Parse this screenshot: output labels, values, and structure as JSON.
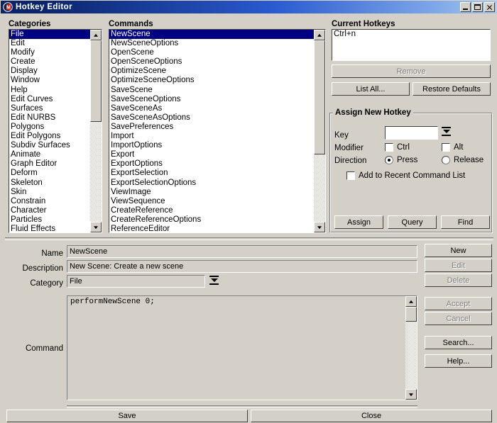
{
  "window": {
    "title": "Hotkey Editor",
    "icon": "maya-m-icon",
    "controls": {
      "minimize": "minimize-icon",
      "maximize": "maximize-icon",
      "close": "close-icon"
    },
    "titlebar_color_start": "#0a246a",
    "titlebar_color_end": "#a6c8f0",
    "face_color": "#d4d0c8",
    "selection_color": "#000080"
  },
  "categories": {
    "label": "Categories",
    "selected": "File",
    "items": [
      "File",
      "Edit",
      "Modify",
      "Create",
      "Display",
      "Window",
      "Help",
      "Edit Curves",
      "Surfaces",
      "Edit NURBS",
      "Polygons",
      "Edit Polygons",
      "Subdiv Surfaces",
      "Animate",
      "Graph Editor",
      "Deform",
      "Skeleton",
      "Skin",
      "Constrain",
      "Character",
      "Particles",
      "Fluid Effects"
    ]
  },
  "commands": {
    "label": "Commands",
    "selected": "NewScene",
    "items": [
      "NewScene",
      "NewSceneOptions",
      "OpenScene",
      "OpenSceneOptions",
      "OptimizeScene",
      "OptimizeSceneOptions",
      "SaveScene",
      "SaveSceneOptions",
      "SaveSceneAs",
      "SaveSceneAsOptions",
      "SavePreferences",
      "Import",
      "ImportOptions",
      "Export",
      "ExportOptions",
      "ExportSelection",
      "ExportSelectionOptions",
      "ViewImage",
      "ViewSequence",
      "CreateReference",
      "CreateReferenceOptions",
      "ReferenceEditor"
    ]
  },
  "current_hotkeys": {
    "label": "Current Hotkeys",
    "items": [
      "Ctrl+n"
    ],
    "remove_button": "Remove",
    "remove_enabled": false,
    "list_all_button": "List All...",
    "restore_defaults_button": "Restore Defaults"
  },
  "assign_new_hotkey": {
    "label": "Assign New Hotkey",
    "key_label": "Key",
    "key_value": "",
    "key_dropdown_icon": "option-menu-icon",
    "modifier_label": "Modifier",
    "modifiers": [
      {
        "label": "Ctrl",
        "checked": false
      },
      {
        "label": "Alt",
        "checked": false
      }
    ],
    "direction_label": "Direction",
    "directions": [
      {
        "label": "Press",
        "selected": true
      },
      {
        "label": "Release",
        "selected": false
      }
    ],
    "add_recent": {
      "label": "Add to Recent Command List",
      "checked": false
    },
    "buttons": [
      "Assign",
      "Query",
      "Find"
    ]
  },
  "details": {
    "name_label": "Name",
    "name_value": "NewScene",
    "description_label": "Description",
    "description_value": "New Scene: Create a new scene",
    "category_label": "Category",
    "category_value": "File",
    "category_dropdown_icon": "option-menu-icon",
    "command_label": "Command",
    "command_value": "performNewScene 0;"
  },
  "action_buttons": [
    {
      "label": "New",
      "enabled": true
    },
    {
      "label": "Edit",
      "enabled": false
    },
    {
      "label": "Delete",
      "enabled": false
    },
    {
      "label": "Accept",
      "enabled": false
    },
    {
      "label": "Cancel",
      "enabled": false
    },
    {
      "label": "Search...",
      "enabled": true
    },
    {
      "label": "Help...",
      "enabled": true
    }
  ],
  "footer": {
    "save_label": "Save",
    "close_label": "Close"
  }
}
